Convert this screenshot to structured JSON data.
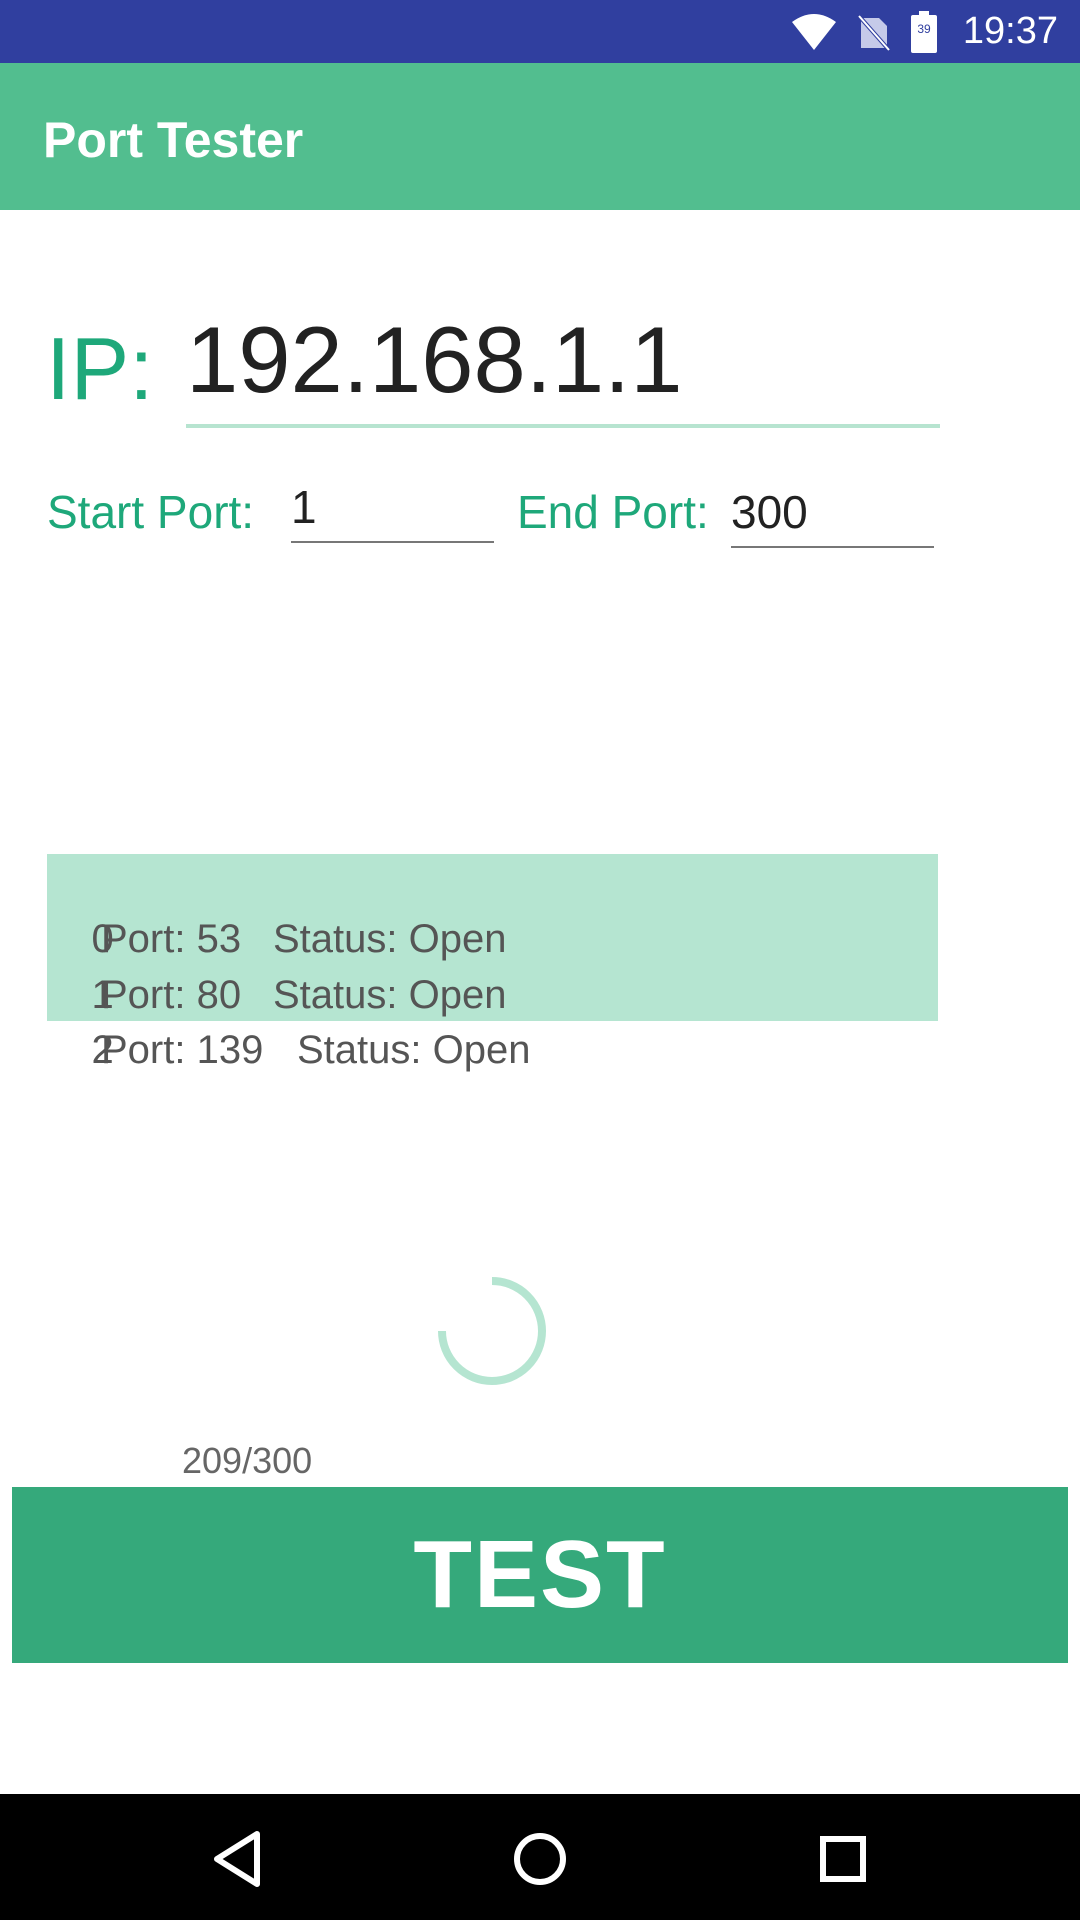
{
  "status_bar": {
    "time": "19:37",
    "battery_level": "39"
  },
  "app_bar": {
    "title": "Port Tester"
  },
  "form": {
    "ip_label": "IP:",
    "ip_value": "192.168.1.1",
    "start_port_label": "Start Port:",
    "start_port_value": "1",
    "end_port_label": "End Port:",
    "end_port_value": "300"
  },
  "results": [
    {
      "index": "0",
      "port": "Port: 53",
      "status": "Status: Open"
    },
    {
      "index": "1",
      "port": "Port: 80",
      "status": "Status: Open"
    },
    {
      "index": "2",
      "port": "Port: 139",
      "status": "Status: Open"
    }
  ],
  "progress": {
    "text": "209/300"
  },
  "test_button": {
    "label": "TEST"
  },
  "colors": {
    "status_bar": "#303f9f",
    "app_bar": "#52be8f",
    "accent": "#1ea87a",
    "results_bg": "#b5e5d1",
    "button": "#35a97b"
  }
}
